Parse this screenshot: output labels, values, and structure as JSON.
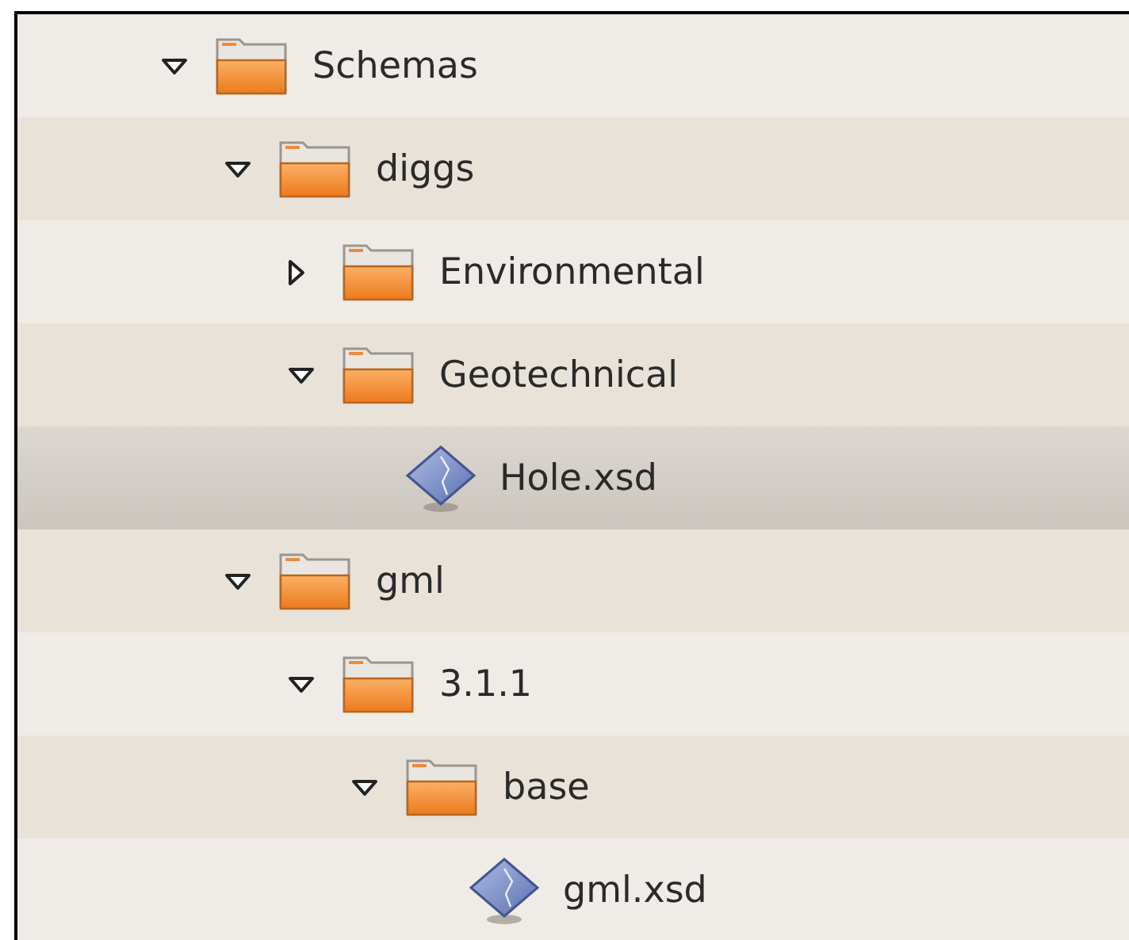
{
  "tree": [
    {
      "kind": "folder",
      "name": "Schemas",
      "expanded": true,
      "selected": false,
      "children": [
        {
          "kind": "folder",
          "name": "diggs",
          "expanded": true,
          "selected": false,
          "children": [
            {
              "kind": "folder",
              "name": "Environmental",
              "expanded": false,
              "selected": false
            },
            {
              "kind": "folder",
              "name": "Geotechnical",
              "expanded": true,
              "selected": false,
              "children": [
                {
                  "kind": "file",
                  "name": "Hole.xsd",
                  "selected": true
                }
              ]
            }
          ]
        },
        {
          "kind": "folder",
          "name": "gml",
          "expanded": true,
          "selected": false,
          "children": [
            {
              "kind": "folder",
              "name": "3.1.1",
              "expanded": true,
              "selected": false,
              "children": [
                {
                  "kind": "folder",
                  "name": "base",
                  "expanded": true,
                  "selected": false,
                  "children": [
                    {
                      "kind": "file",
                      "name": "gml.xsd",
                      "selected": false
                    }
                  ]
                }
              ]
            }
          ]
        }
      ]
    }
  ]
}
